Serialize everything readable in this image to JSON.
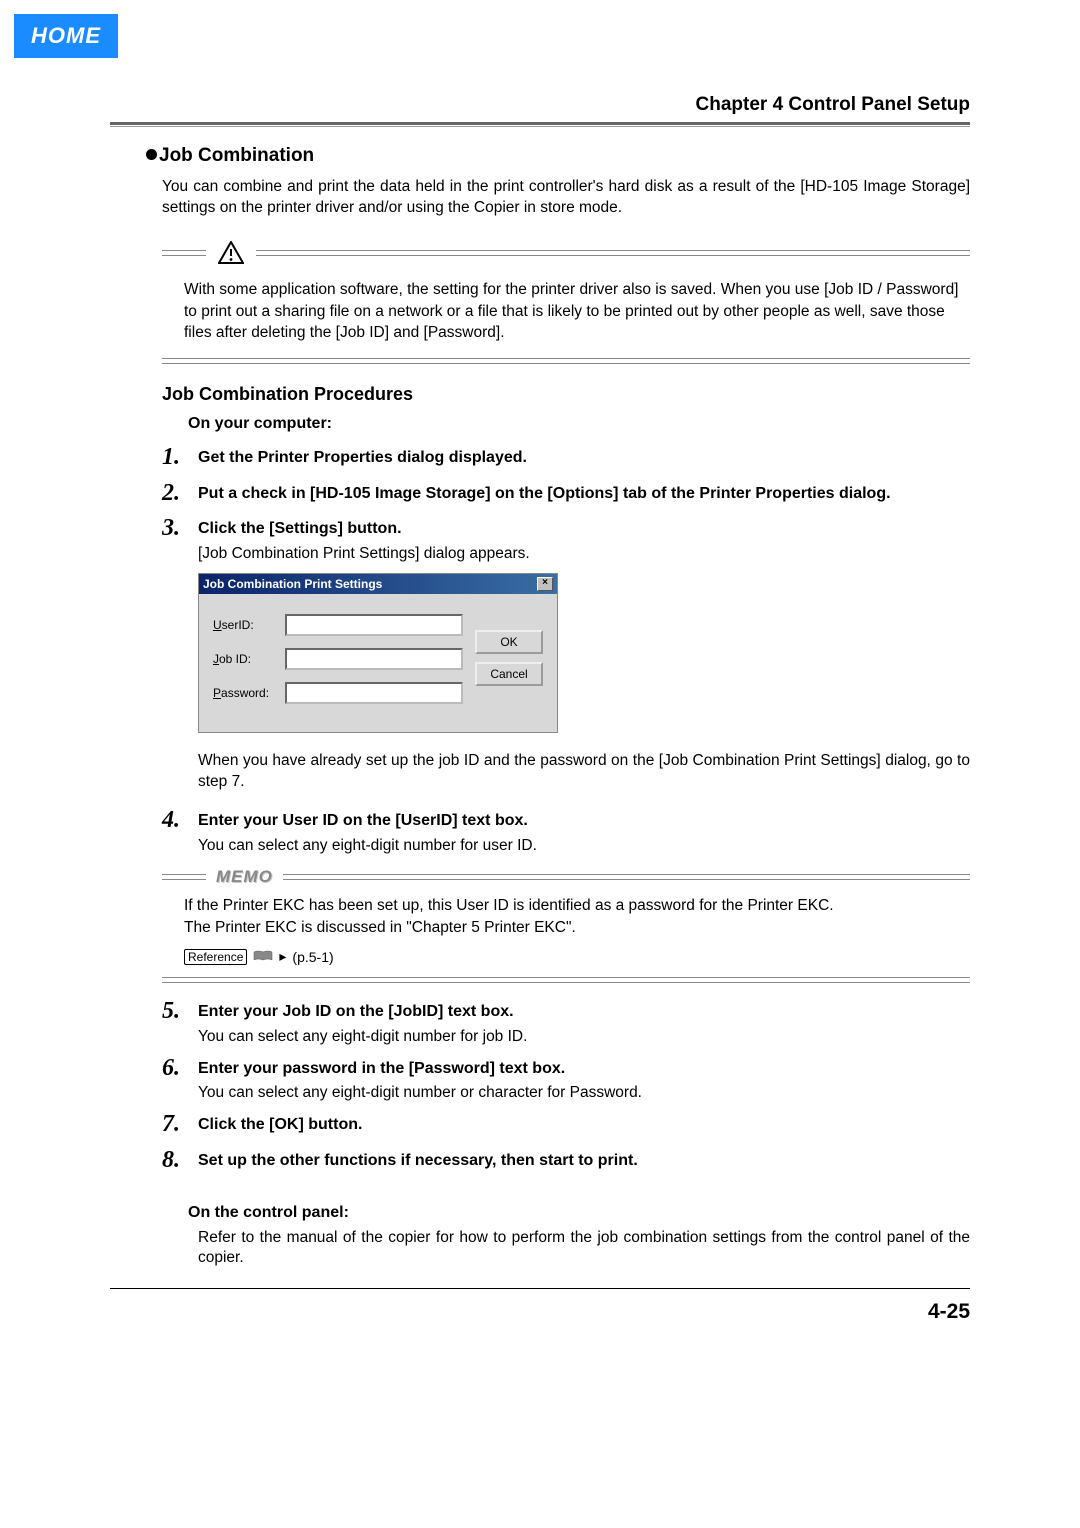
{
  "home_tab": "HOME",
  "chapter_title": "Chapter 4 Control Panel Setup",
  "section": "Job Combination",
  "intro": "You can combine and print the data held in the print controller's hard disk as a result of the [HD-105 Image Storage] settings on the printer driver and/or using the Copier in store mode.",
  "caution": "With some application software, the setting for the printer driver also is saved. When you use [Job ID / Password] to print out a sharing file on a network or a file that is likely to be printed out by other people as well, save those files after deleting the [Job ID] and [Password].",
  "procedures_heading": "Job Combination Procedures",
  "on_computer": "On your computer:",
  "steps": {
    "s1": "Get the Printer Properties dialog displayed.",
    "s2": "Put a check in [HD-105 Image Storage] on the [Options] tab of the Printer Properties dialog.",
    "s3": "Click the [Settings] button.",
    "s3_note": "[Job Combination Print Settings] dialog appears.",
    "s3_after": "When you have already set up the job ID and the password on the [Job Combination Print Settings] dialog, go to step 7.",
    "s4": "Enter your User ID on the [UserID] text box.",
    "s4_note": "You can select any eight-digit number for user ID.",
    "s5": "Enter your Job ID on the [JobID] text box.",
    "s5_note": "You can select any eight-digit number for job ID.",
    "s6": "Enter your password in the [Password] text box.",
    "s6_note": "You can select any eight-digit number or character for Password.",
    "s7": "Click the [OK] button.",
    "s8": "Set up the other functions if necessary, then start to print."
  },
  "dialog": {
    "title": "Job Combination Print Settings",
    "user_id_label": "UserID:",
    "job_id_label": "Job ID:",
    "password_label": "Password:",
    "ok": "OK",
    "cancel": "Cancel"
  },
  "memo_label": "MEMO",
  "memo_text1": "If the Printer EKC has been set up, this User ID is identified as a password for the Printer EKC.",
  "memo_text2": "The Printer EKC is discussed in \"Chapter 5 Printer EKC\".",
  "reference_label": "Reference",
  "reference_page": "(p.5-1)",
  "on_panel": "On the control panel:",
  "on_panel_text": "Refer to the manual of the copier for how to perform the job combination settings from the control panel of the copier.",
  "page_number": "4-25"
}
